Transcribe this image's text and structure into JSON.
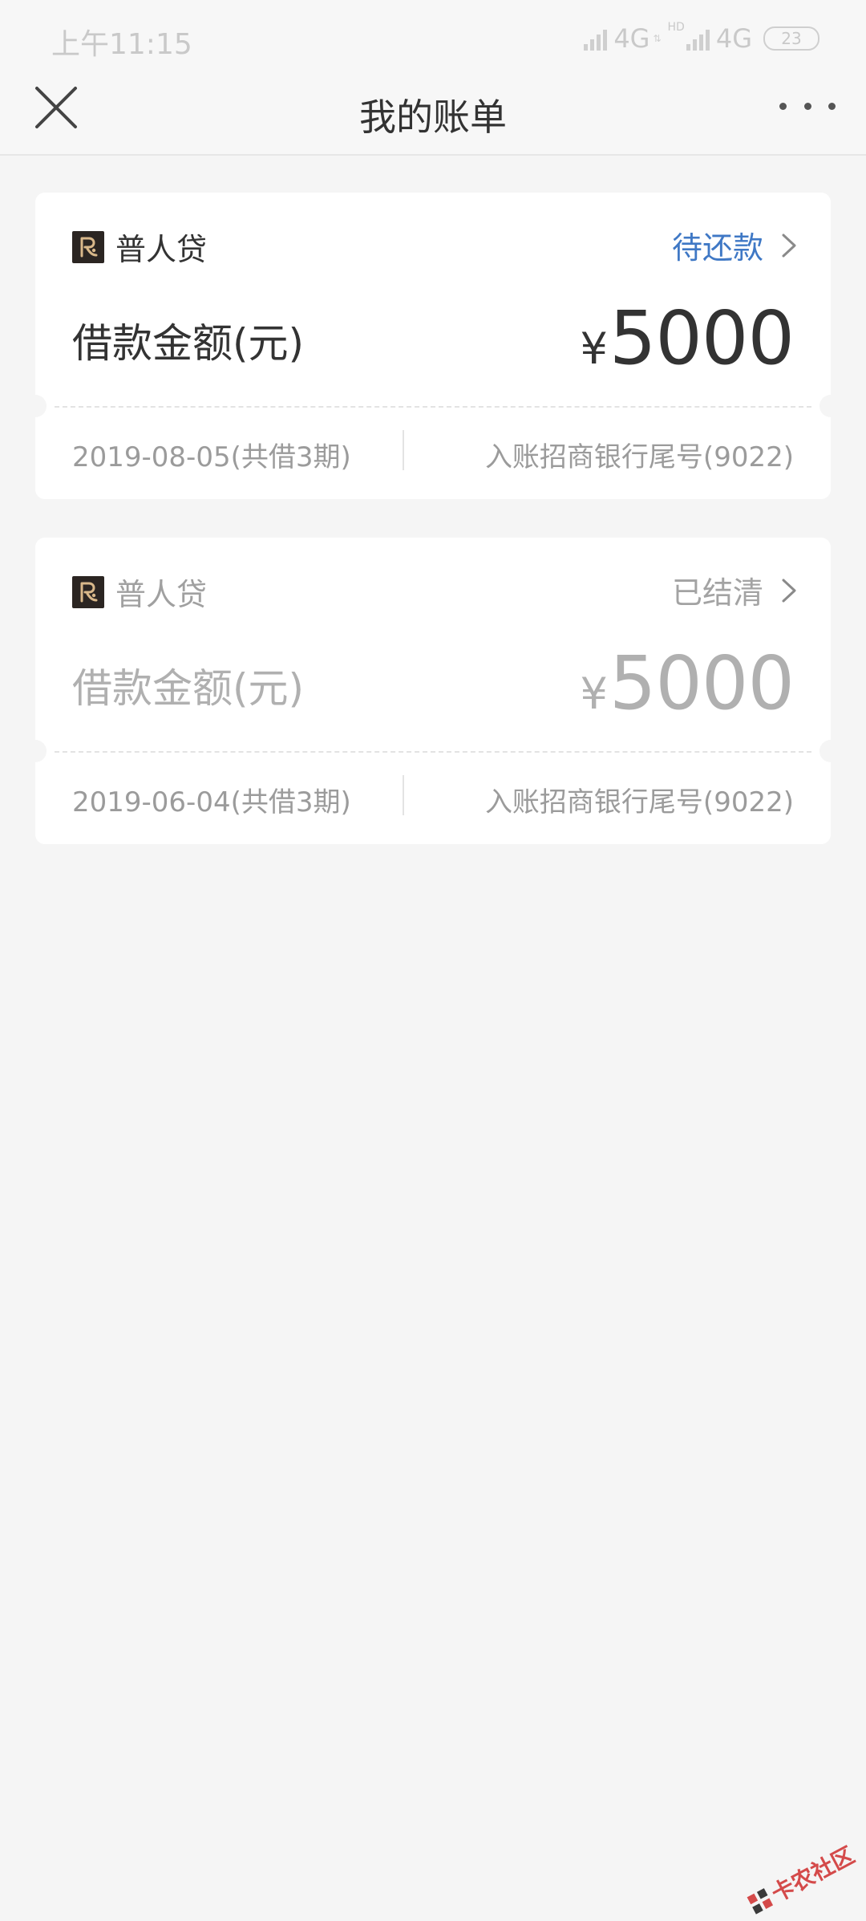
{
  "status_bar": {
    "time": "上午11:15",
    "network_1": "4G",
    "hd_label": "HD",
    "network_2": "4G",
    "battery": "23",
    "icons": [
      "signal-icon",
      "signal-icon",
      "battery-icon"
    ]
  },
  "navbar": {
    "title": "我的账单",
    "close_icon": "close-icon",
    "more_icon": "more-icon"
  },
  "bills": [
    {
      "brand": "普人贷",
      "status": "待还款",
      "status_color": "#3f78c5",
      "amount_label": "借款金额(元)",
      "currency": "¥",
      "amount": "5000",
      "date": "2019-08-05(共借3期)",
      "bank": "入账招商银行尾号(9022)"
    },
    {
      "brand": "普人贷",
      "status": "已结清",
      "status_color": "#a3a3a3",
      "amount_label": "借款金额(元)",
      "currency": "¥",
      "amount": "5000",
      "date": "2019-06-04(共借3期)",
      "bank": "入账招商银行尾号(9022)"
    }
  ],
  "watermark": {
    "text": "卡农社区"
  }
}
